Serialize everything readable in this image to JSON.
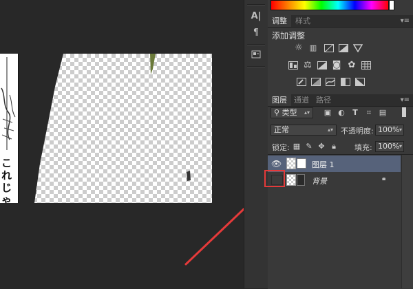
{
  "colors": {
    "accent_red": "#e53a3a",
    "selected_layer": "#56627a"
  },
  "adjustments_panel": {
    "tabs": [
      "调整",
      "样式"
    ],
    "title": "添加调整",
    "icons": [
      "brightness-contrast",
      "levels",
      "curves",
      "exposure",
      "gradient-triangle",
      "vibrance",
      "hue-saturation",
      "color-balance",
      "black-white",
      "photo-filter",
      "channel-mixer",
      "color-lookup",
      "invert",
      "posterize",
      "threshold",
      "selective-color",
      "gradient-map"
    ]
  },
  "layers_panel": {
    "tabs": [
      "图层",
      "通道",
      "路径"
    ],
    "filter_label": "类型",
    "blend_mode": "正常",
    "opacity_label": "不透明度:",
    "opacity_value": "100%",
    "lock_label": "锁定:",
    "fill_label": "填充:",
    "fill_value": "100%",
    "layers": [
      {
        "name": "图层 1",
        "visible": true,
        "selected": true
      },
      {
        "name": "背景",
        "visible": false,
        "selected": false,
        "locked": true
      }
    ]
  },
  "canvas": {
    "manga_text": "これじゃ"
  }
}
